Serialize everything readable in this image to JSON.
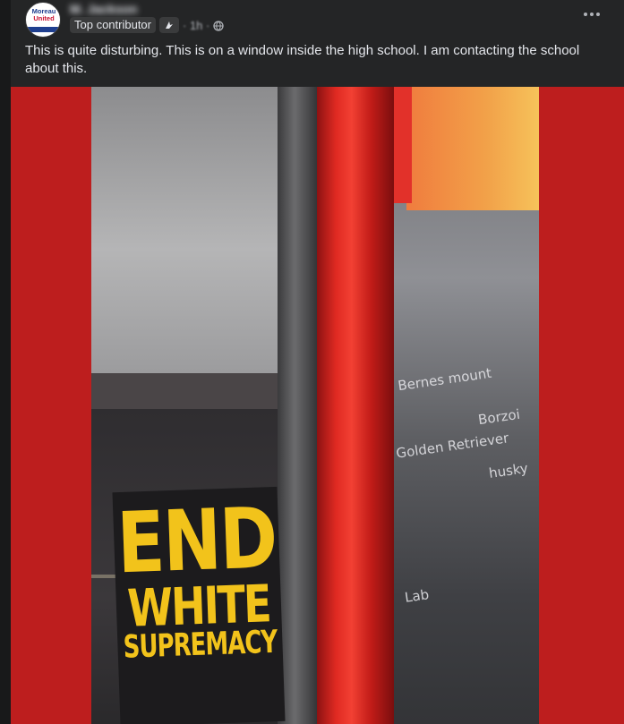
{
  "post": {
    "author_name": "M. Jackson",
    "avatar_text_line1": "Moreau",
    "avatar_text_line2": "United",
    "badge": "Top contributor",
    "time": "· 1h ·",
    "text": "This is quite disturbing. This is on a window inside the high school.  I am contacting the school about this."
  },
  "icons": {
    "more": "more-icon",
    "globe": "globe-icon",
    "contributor": "contributor-icon"
  },
  "photo": {
    "sign_line1": "END",
    "sign_line2": "WHITE",
    "sign_line3": "SUPREMACY",
    "chalk_words": [
      "Bernes mount",
      "Golden Retriever",
      "Borzoi",
      "husky",
      "Lab"
    ]
  },
  "colors": {
    "background": "#18191a",
    "card": "#242526",
    "text_primary": "#e4e6eb",
    "text_secondary": "#b0b3b8",
    "media_background": "#bd1e1e",
    "sign_text": "#f2c31b"
  }
}
